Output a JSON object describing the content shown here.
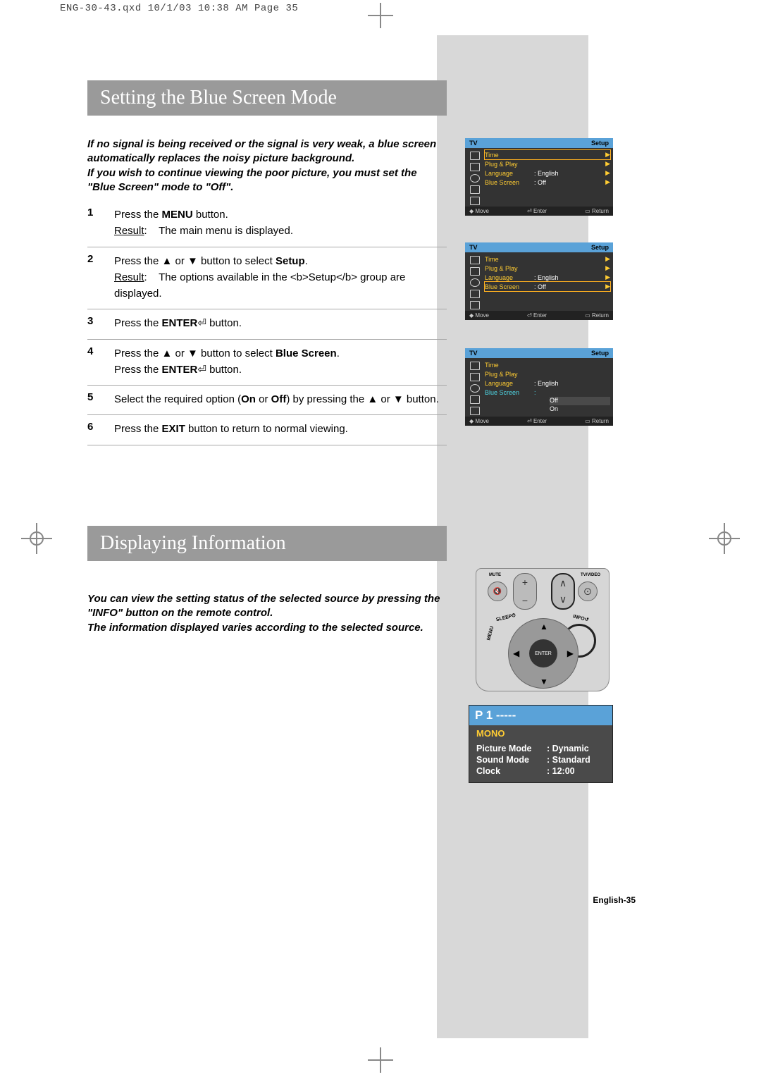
{
  "header_meta": "ENG-30-43.qxd  10/1/03 10:38 AM  Page 35",
  "section1_title": "Setting the Blue Screen Mode",
  "section2_title": "Displaying Information",
  "intro1_line1": "If no signal is being received or the signal is very weak, a blue screen automatically replaces the noisy picture background.",
  "intro1_line2": "If you wish to continue viewing the poor picture, you must set the \"Blue Screen\" mode to \"Off\".",
  "intro2_line1": "You can view the setting status of the selected source by pressing the \"INFO\" button on the remote control.",
  "intro2_line2": "The information displayed varies according to the selected source.",
  "steps": [
    {
      "n": "1",
      "body": "Press the <b>MENU</b> button.",
      "result": "The main menu is displayed."
    },
    {
      "n": "2",
      "body": "Press the ▲ or ▼ button to select <b>Setup</b>.",
      "result": "The options available in the <b>Setup</b> group are displayed."
    },
    {
      "n": "3",
      "body": "Press the <b>ENTER</b>⏎ button."
    },
    {
      "n": "4",
      "body": "Press the ▲ or ▼ button to select <b>Blue Screen</b>.<br>Press the <b>ENTER</b>⏎ button."
    },
    {
      "n": "5",
      "body": "Select the required option (<b>On</b> or <b>Off</b>) by pressing the ▲ or ▼ button."
    },
    {
      "n": "6",
      "body": "Press the <b>EXIT</b> button to return to normal viewing."
    }
  ],
  "osd_tv": "TV",
  "osd_setup": "Setup",
  "osd_menu_items": {
    "time": "Time",
    "plug_play": "Plug & Play",
    "language": "Language",
    "blue_screen": "Blue Screen"
  },
  "osd_vals": {
    "english": "English",
    "off": "Off",
    "on": "On"
  },
  "osd_footer": {
    "move": "Move",
    "enter": "Enter",
    "return": "Return"
  },
  "remote": {
    "mute": "MUTE",
    "tvvideo": "TV/VIDEO",
    "sleep": "SLEEP",
    "menu": "MENU",
    "info": "INFO",
    "enter": "ENTER"
  },
  "info_panel": {
    "header": "P 1   -----",
    "mono": "MONO",
    "rows": [
      {
        "k": "Picture Mode",
        "v": "Dynamic"
      },
      {
        "k": "Sound Mode",
        "v": "Standard"
      },
      {
        "k": "Clock",
        "v": "12:00"
      }
    ]
  },
  "page_footer": "English-35",
  "glyph_up": "▲",
  "glyph_dn": "▼",
  "glyph_right": "▶",
  "glyph_updn": "◆",
  "glyph_enter": "⏎",
  "glyph_return": "▭",
  "glyph_plus": "+",
  "glyph_minus": "−"
}
